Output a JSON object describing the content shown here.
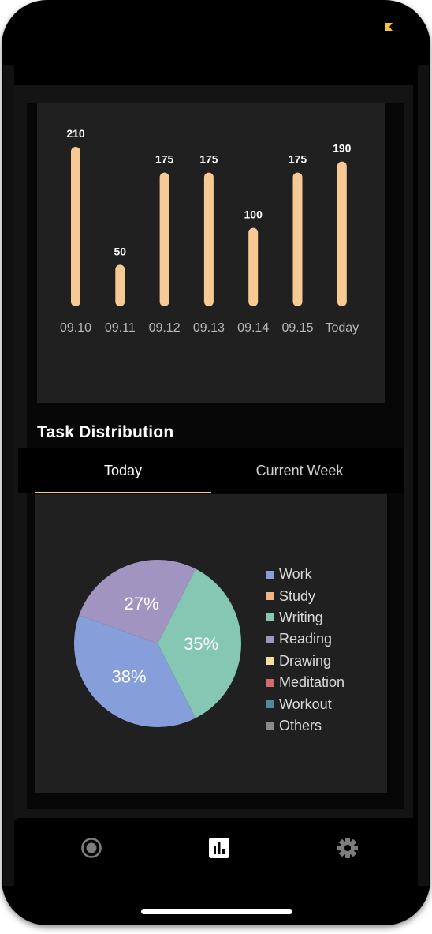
{
  "colors": {
    "bar": "#f7c995",
    "accent": "#f7c995",
    "work": "#869ed9",
    "study": "#f0b48a",
    "writing": "#86c7b4",
    "reading": "#a294c0",
    "drawing": "#f2dea2",
    "meditation": "#d56c6c",
    "workout": "#4c8c98",
    "others": "#8a8a8a"
  },
  "chart_data": [
    {
      "type": "bar",
      "categories": [
        "09.10",
        "09.11",
        "09.12",
        "09.13",
        "09.14",
        "09.15",
        "Today"
      ],
      "values": [
        210,
        50,
        175,
        175,
        100,
        175,
        190
      ],
      "data_labels": [
        "210",
        "50",
        "175",
        "175",
        "100",
        "175",
        "190"
      ],
      "title": "",
      "xlabel": "",
      "ylabel": "",
      "ylim": [
        0,
        210
      ],
      "grid": false
    },
    {
      "type": "pie",
      "slices": [
        {
          "label": "Work",
          "value": 38,
          "display": "38%",
          "color": "#869ed9"
        },
        {
          "label": "Writing",
          "value": 35,
          "display": "35%",
          "color": "#86c7b4"
        },
        {
          "label": "Reading",
          "value": 27,
          "display": "27%",
          "color": "#a294c0"
        }
      ],
      "legend": [
        "Work",
        "Study",
        "Writing",
        "Reading",
        "Drawing",
        "Meditation",
        "Workout",
        "Others"
      ],
      "legend_placement": "right"
    }
  ],
  "section": {
    "title": "Task Distribution"
  },
  "tabs": [
    {
      "label": "Today",
      "selected": true
    },
    {
      "label": "Current Week",
      "selected": false
    }
  ],
  "legend_items": [
    {
      "label": "Work",
      "color": "#869ed9"
    },
    {
      "label": "Study",
      "color": "#f0b48a"
    },
    {
      "label": "Writing",
      "color": "#86c7b4"
    },
    {
      "label": "Reading",
      "color": "#a294c0"
    },
    {
      "label": "Drawing",
      "color": "#f2dea2"
    },
    {
      "label": "Meditation",
      "color": "#d56c6c"
    },
    {
      "label": "Workout",
      "color": "#4c8c98"
    },
    {
      "label": "Others",
      "color": "#8a8a8a"
    }
  ],
  "nav": [
    {
      "icon": "record-icon",
      "selected": false
    },
    {
      "icon": "bar-chart-icon",
      "selected": true
    },
    {
      "icon": "gear-icon",
      "selected": false
    }
  ]
}
